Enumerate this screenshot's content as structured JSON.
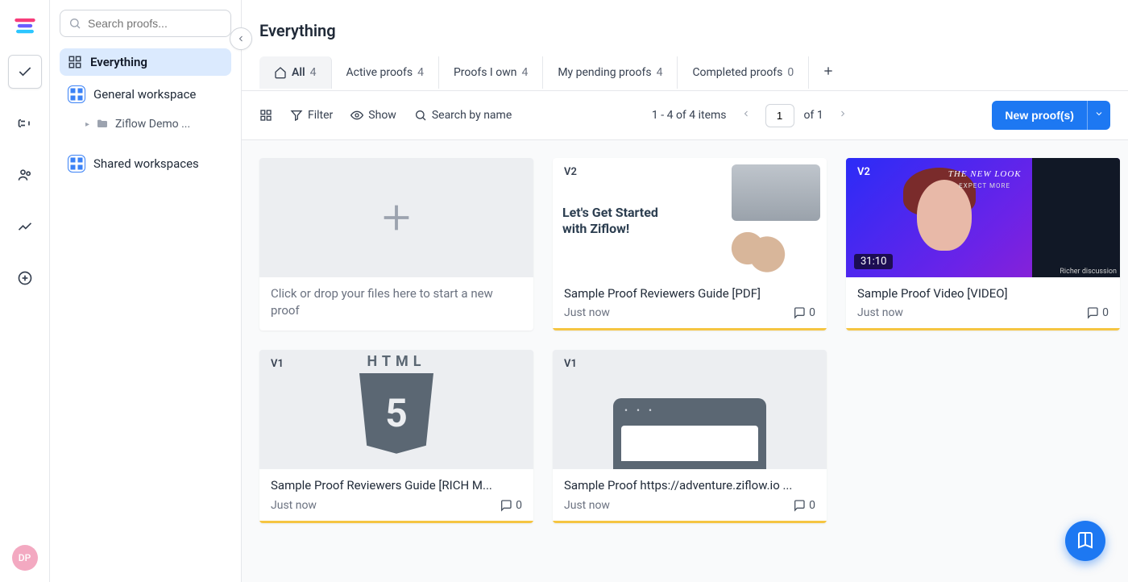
{
  "search": {
    "placeholder": "Search proofs..."
  },
  "page": {
    "title": "Everything"
  },
  "tabs": [
    {
      "label": "All",
      "count": "4",
      "icon": "home"
    },
    {
      "label": "Active proofs",
      "count": "4"
    },
    {
      "label": "Proofs I own",
      "count": "4"
    },
    {
      "label": "My pending proofs",
      "count": "4"
    },
    {
      "label": "Completed proofs",
      "count": "0"
    }
  ],
  "toolbar": {
    "filter": "Filter",
    "show": "Show",
    "search": "Search by name",
    "items_summary": "1 - 4 of 4 items",
    "page_current": "1",
    "page_total_prefix": "of",
    "page_total": "1",
    "new_proof": "New proof(s)"
  },
  "sidebar": {
    "everything": "Everything",
    "general": "General workspace",
    "demo_folder": "Ziflow Demo ...",
    "shared": "Shared workspaces"
  },
  "drop": {
    "text": "Click or drop your files here to start a new proof"
  },
  "cards": [
    {
      "version": "V2",
      "title": "Sample Proof Reviewers Guide [PDF]",
      "time": "Just now",
      "comments": "0"
    },
    {
      "version": "V2",
      "title": "Sample Proof Video [VIDEO]",
      "time": "Just now",
      "comments": "0",
      "duration": "31:10"
    },
    {
      "version": "V1",
      "title": "Sample Proof Reviewers Guide [RICH M...",
      "time": "Just now",
      "comments": "0"
    },
    {
      "version": "V1",
      "title": "Sample Proof https://adventure.ziflow.io ...",
      "time": "Just now",
      "comments": "0"
    }
  ],
  "video_overlay": {
    "headline": "THE NEW LOOK",
    "sub": "EXPECT MORE",
    "footer": "Richer discussion"
  },
  "pdf_overlay": {
    "line1": "Let's Get Started",
    "line2": "with Ziflow!"
  },
  "avatar": "DP"
}
